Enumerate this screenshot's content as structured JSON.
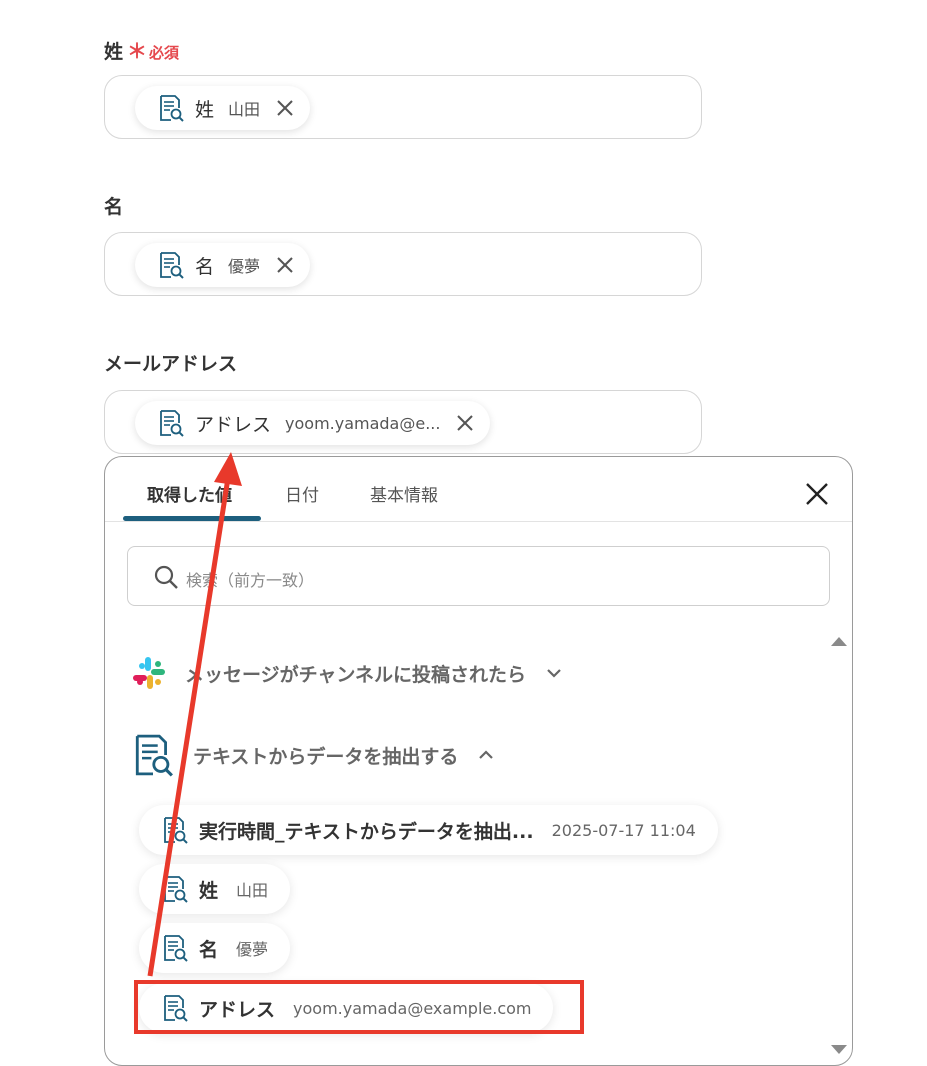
{
  "form": {
    "last_name": {
      "label": "姓",
      "required_star": "＊",
      "required_text": "必須",
      "chip_name": "姓",
      "chip_value": "山田"
    },
    "first_name": {
      "label": "名",
      "chip_name": "名",
      "chip_value": "優夢"
    },
    "email": {
      "label": "メールアドレス",
      "chip_name": "アドレス",
      "chip_value": "yoom.yamada@e..."
    }
  },
  "panel": {
    "tabs": [
      {
        "label": "取得した値",
        "active": true
      },
      {
        "label": "日付",
        "active": false
      },
      {
        "label": "基本情報",
        "active": false
      }
    ],
    "search_placeholder": "検索（前方一致）",
    "groups": [
      {
        "title": "メッセージがチャンネルに投稿されたら",
        "icon": "slack-icon",
        "expanded": false
      },
      {
        "title": "テキストからデータを抽出する",
        "icon": "document-search-icon",
        "expanded": true
      }
    ],
    "items": [
      {
        "name": "実行時間_テキストからデータを抽出...",
        "value": "2025-07-17 11:04"
      },
      {
        "name": "姓",
        "value": "山田"
      },
      {
        "name": "名",
        "value": "優夢"
      },
      {
        "name": "アドレス",
        "value": "yoom.yamada@example.com"
      }
    ]
  },
  "colors": {
    "accent": "#1d5f7e",
    "required": "#e5484d",
    "annotation": "#e8392b"
  }
}
